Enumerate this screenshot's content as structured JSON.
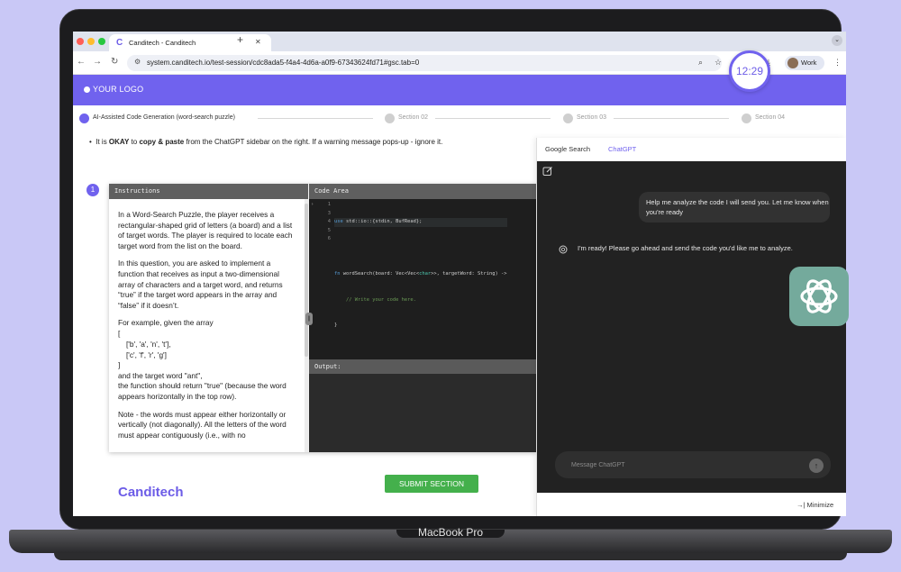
{
  "device": {
    "label": "MacBook Pro"
  },
  "browser": {
    "tab_title": "Canditech - Canditech",
    "tab_logo": "C",
    "url": "system.canditech.io/test-session/cdc8ada5-f4a4-4d6a-a0f9-67343624fd71#gsc.tab=0",
    "profile": "Work",
    "icons": [
      "back-icon",
      "forward-icon",
      "reload-icon",
      "zoom-icon",
      "star-icon",
      "extensions-icon",
      "download-icon",
      "menu-icon"
    ]
  },
  "header": {
    "logo": "YOUR LOGO",
    "timer": "12:29",
    "accent": "#7062ee"
  },
  "steps": [
    {
      "num": "1",
      "label": "AI-Assisted Code Generation (word-search puzzle)",
      "active": true
    },
    {
      "num": "2",
      "label": "Section 02",
      "active": false
    },
    {
      "num": "3",
      "label": "Section 03",
      "active": false
    },
    {
      "num": "4",
      "label": "Section 04",
      "active": false
    }
  ],
  "note": {
    "pre": "It is ",
    "bold1": "OKAY",
    "mid": " to ",
    "bold2": "copy & paste",
    "post": " from the ChatGPT sidebar on the right. If a warning message pops-up - ignore it."
  },
  "question": {
    "number": "1",
    "instructions_title": "Instructions",
    "paragraphs": [
      "In a Word-Search Puzzle, the player receives a rectangular-shaped grid of letters (a board) and a list of target words. The player is required to locate each target word from the list on the board.",
      "In this question, you are asked to implement a function that receives as input a two-dimensional array of characters and a target word, and returns “true” if the target word appears in the array and “false” if it doesn’t."
    ],
    "example_intro": "For example, given the array",
    "example_lines": [
      "[",
      "['b', 'a', 'n', 't'],",
      "['c', 'f', 'r', 'g']",
      "]",
      "and the target word \"ant\",",
      "the function should return \"true\" (because the word appears horizontally in the top row)."
    ],
    "note": "Note - the words must appear either horizontally or vertically (not diagonally). All the letters of the word must appear contiguously (i.e., with no",
    "code_title": "Code Area",
    "code": {
      "line_numbers": [
        "1",
        "3",
        "4",
        "5",
        "6"
      ],
      "line1_kw": "use",
      "line1_rest": " std::io::{stdin, BufRead};",
      "line4_kw": "fn",
      "line4_a": " wordSearch(board: Vec<Vec<",
      "line4_ty": "char",
      "line4_b": ">>, targetWord: String) ->",
      "line5": "// Write your code here.",
      "line6": "}"
    },
    "output_title": "Output:"
  },
  "footer": {
    "brand": "Canditech",
    "submit": "SUBMIT SECTION",
    "submit_color": "#44b04c"
  },
  "chat": {
    "tabs": [
      "Google Search",
      "ChatGPT"
    ],
    "active_tab": "ChatGPT",
    "user_message": "Help me analyze the code I will send you. Let me know when you're ready",
    "assistant_message": "I'm ready! Please go ahead and send the code you'd like me to analyze.",
    "input_placeholder": "Message ChatGPT",
    "minimize": "Minimize"
  }
}
